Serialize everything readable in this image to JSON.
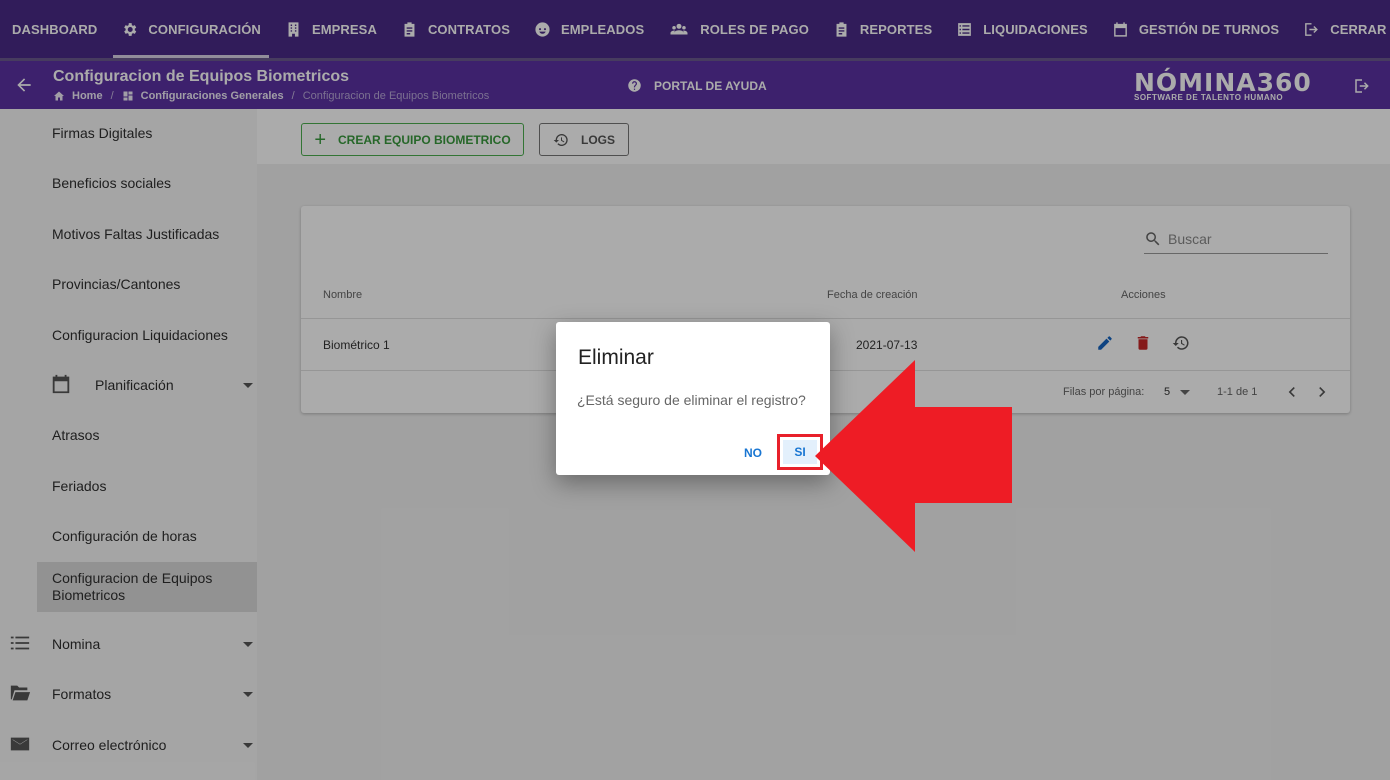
{
  "topnav": {
    "items": [
      {
        "label": "DASHBOARD",
        "icon": ""
      },
      {
        "label": "CONFIGURACIÓN",
        "icon": "gear-icon"
      },
      {
        "label": "EMPRESA",
        "icon": "building-icon"
      },
      {
        "label": "CONTRATOS",
        "icon": "clipboard-icon"
      },
      {
        "label": "EMPLEADOS",
        "icon": "face-icon"
      },
      {
        "label": "ROLES DE PAGO",
        "icon": "group-icon"
      },
      {
        "label": "REPORTES",
        "icon": "clipboard-icon"
      },
      {
        "label": "LIQUIDACIONES",
        "icon": "list-icon"
      },
      {
        "label": "GESTIÓN DE TURNOS",
        "icon": "calendar-icon"
      },
      {
        "label": "CERRAR SESIÓN",
        "icon": "logout-icon"
      }
    ]
  },
  "header": {
    "title": "Configuracion de Equipos Biometricos",
    "breadcrumb": {
      "home": "Home",
      "section": "Configuraciones Generales",
      "current": "Configuracion de Equipos Biometricos"
    },
    "help": "PORTAL DE AYUDA",
    "logo": {
      "brand": "NÓMINA360",
      "tagline": "SOFTWARE DE TALENTO HUMANO"
    }
  },
  "sidebar": {
    "items": [
      {
        "label": "Firmas Digitales"
      },
      {
        "label": "Beneficios sociales"
      },
      {
        "label": "Motivos Faltas Justificadas"
      },
      {
        "label": "Provincias/Cantones"
      },
      {
        "label": "Configuracion Liquidaciones"
      },
      {
        "label": "Planificación"
      },
      {
        "label": "Atrasos"
      },
      {
        "label": "Feriados"
      },
      {
        "label": "Configuración de horas"
      },
      {
        "label": "Configuracion de Equipos Biometricos"
      },
      {
        "label": "Nomina"
      },
      {
        "label": "Formatos"
      },
      {
        "label": "Correo electrónico"
      }
    ]
  },
  "toolbar": {
    "create_label": "CREAR EQUIPO BIOMETRICO",
    "logs_label": "LOGS"
  },
  "table": {
    "search_placeholder": "Buscar",
    "columns": [
      "Nombre",
      "Fecha de creación",
      "Acciones"
    ],
    "rows": [
      {
        "nombre": "Biométrico 1",
        "fecha": "2021-07-13"
      }
    ],
    "footer": {
      "rows_per_page_label": "Filas por página:",
      "rows_per_page": "5",
      "range": "1-1 de 1"
    }
  },
  "dialog": {
    "title": "Eliminar",
    "message": "¿Está seguro de eliminar el registro?",
    "no_label": "NO",
    "si_label": "SI"
  },
  "colors": {
    "nav": "#4a2a86",
    "header": "#5b32a3",
    "accent_green": "#4caf50",
    "edit_blue": "#1565c0",
    "delete_red": "#c62828",
    "highlight_red": "#e8202a"
  }
}
